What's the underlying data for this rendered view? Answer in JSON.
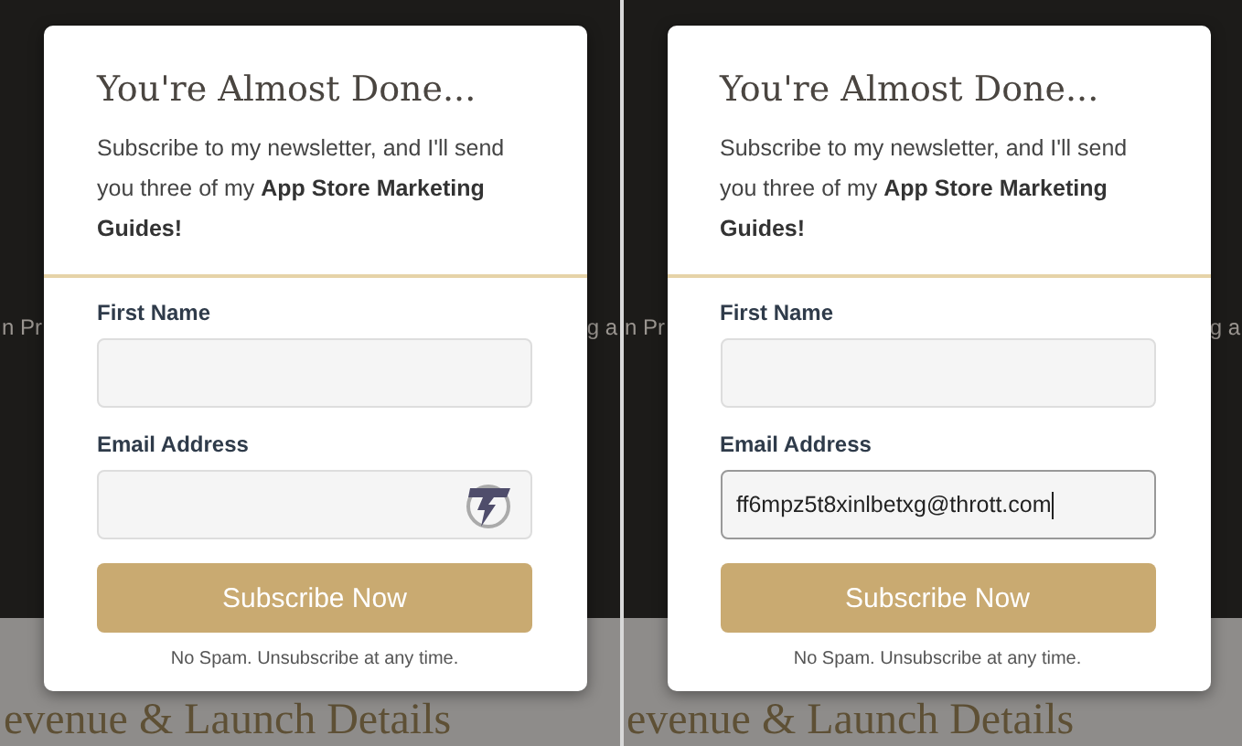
{
  "panels": [
    {
      "backdrop": {
        "left_text": "n Pr",
        "right_text": "g a",
        "heading": "evenue & Launch Details"
      },
      "title": "You're Almost Done...",
      "intro": "Subscribe to my newsletter, and I'll send you three of my **App Store Marketing Guides!**",
      "fields": [
        {
          "kind": "text",
          "label": "First Name",
          "focused": false
        },
        {
          "kind": "email",
          "label": "Email Address",
          "focused": false
        }
      ],
      "button": "Subscribe Now",
      "footnote": "No Spam. Unsubscribe at any time."
    },
    {
      "backdrop": {
        "left_text": "n Pr",
        "right_text": "g a",
        "heading": "evenue & Launch Details"
      },
      "title": "You're Almost Done...",
      "intro": "Subscribe to my newsletter, and I'll send you three of my **App Store Marketing Guides!**",
      "fields": [
        {
          "kind": "text",
          "label": "First Name",
          "focused": false
        },
        {
          "kind": "email",
          "label": "Email Address",
          "value": "ff6mpz5t8xinlbetxg@thrott.com",
          "focused": true
        }
      ],
      "button": "Subscribe Now",
      "footnote": "No Spam. Unsubscribe at any time."
    }
  ]
}
